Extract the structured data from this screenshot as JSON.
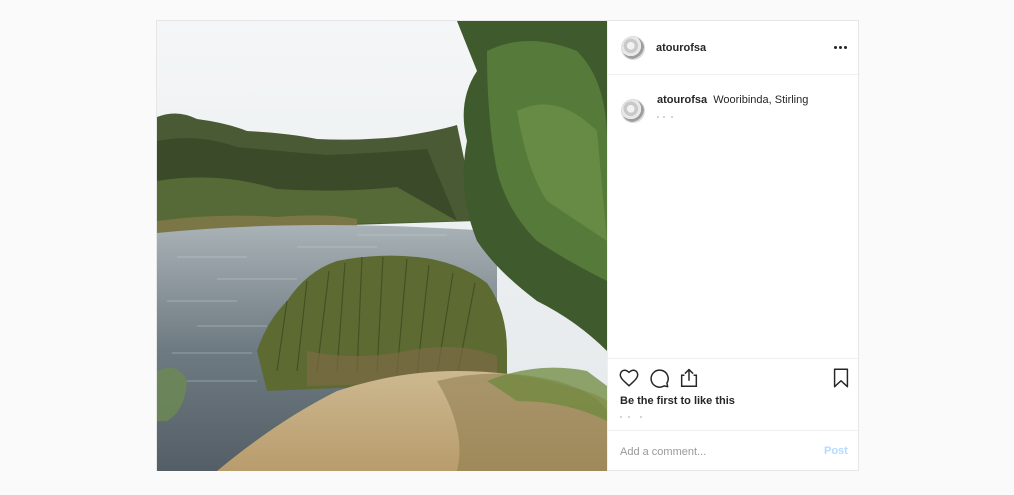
{
  "post": {
    "image_alt": "Lake with reeds, sandy shore and eucalyptus forest",
    "author": {
      "username": "atourofsa",
      "avatar_icon": "profile-avatar-icon"
    },
    "header": {
      "more_icon": "more-options-icon"
    },
    "caption": {
      "username": "atourofsa",
      "text": "Wooribinda, Stirling"
    },
    "actions": {
      "like_icon": "heart-icon",
      "comment_icon": "comment-bubble-icon",
      "share_icon": "share-upload-icon",
      "save_icon": "bookmark-icon"
    },
    "likes_text": "Be the first to like this",
    "comment": {
      "placeholder": "Add a comment...",
      "value": "",
      "post_label": "Post"
    },
    "colors": {
      "post_link_disabled": "#b3dbff",
      "text_primary": "#262626",
      "border": "#efefef",
      "page_background": "#fafafa"
    }
  }
}
